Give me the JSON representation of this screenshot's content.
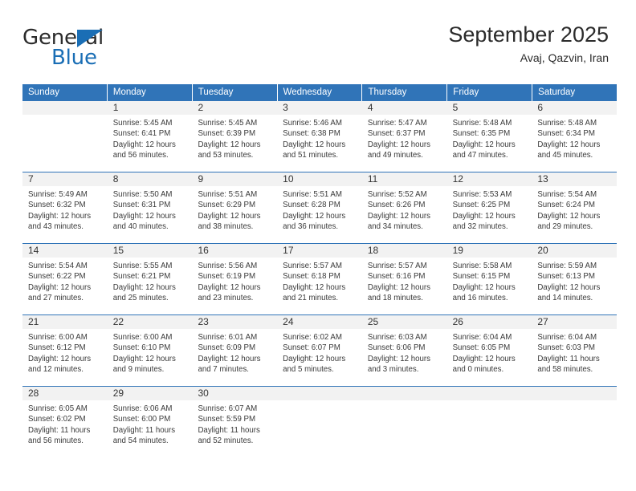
{
  "branding": {
    "logo_text_primary": "General",
    "logo_text_secondary": "Blue",
    "logo_accent_color": "#1a6eb5"
  },
  "header": {
    "title": "September 2025",
    "subtitle": "Avaj, Qazvin, Iran",
    "header_bg_color": "#3074b8",
    "day_band_color": "#f2f2f2"
  },
  "weekdays": [
    "Sunday",
    "Monday",
    "Tuesday",
    "Wednesday",
    "Thursday",
    "Friday",
    "Saturday"
  ],
  "labels": {
    "sunrise_prefix": "Sunrise:",
    "sunset_prefix": "Sunset:",
    "daylight_prefix": "Daylight:"
  },
  "weeks": [
    [
      {
        "day": "",
        "sunrise": "",
        "sunset": "",
        "daylight_line1": "",
        "daylight_line2": ""
      },
      {
        "day": "1",
        "sunrise": "Sunrise: 5:45 AM",
        "sunset": "Sunset: 6:41 PM",
        "daylight_line1": "Daylight: 12 hours",
        "daylight_line2": "and 56 minutes."
      },
      {
        "day": "2",
        "sunrise": "Sunrise: 5:45 AM",
        "sunset": "Sunset: 6:39 PM",
        "daylight_line1": "Daylight: 12 hours",
        "daylight_line2": "and 53 minutes."
      },
      {
        "day": "3",
        "sunrise": "Sunrise: 5:46 AM",
        "sunset": "Sunset: 6:38 PM",
        "daylight_line1": "Daylight: 12 hours",
        "daylight_line2": "and 51 minutes."
      },
      {
        "day": "4",
        "sunrise": "Sunrise: 5:47 AM",
        "sunset": "Sunset: 6:37 PM",
        "daylight_line1": "Daylight: 12 hours",
        "daylight_line2": "and 49 minutes."
      },
      {
        "day": "5",
        "sunrise": "Sunrise: 5:48 AM",
        "sunset": "Sunset: 6:35 PM",
        "daylight_line1": "Daylight: 12 hours",
        "daylight_line2": "and 47 minutes."
      },
      {
        "day": "6",
        "sunrise": "Sunrise: 5:48 AM",
        "sunset": "Sunset: 6:34 PM",
        "daylight_line1": "Daylight: 12 hours",
        "daylight_line2": "and 45 minutes."
      }
    ],
    [
      {
        "day": "7",
        "sunrise": "Sunrise: 5:49 AM",
        "sunset": "Sunset: 6:32 PM",
        "daylight_line1": "Daylight: 12 hours",
        "daylight_line2": "and 43 minutes."
      },
      {
        "day": "8",
        "sunrise": "Sunrise: 5:50 AM",
        "sunset": "Sunset: 6:31 PM",
        "daylight_line1": "Daylight: 12 hours",
        "daylight_line2": "and 40 minutes."
      },
      {
        "day": "9",
        "sunrise": "Sunrise: 5:51 AM",
        "sunset": "Sunset: 6:29 PM",
        "daylight_line1": "Daylight: 12 hours",
        "daylight_line2": "and 38 minutes."
      },
      {
        "day": "10",
        "sunrise": "Sunrise: 5:51 AM",
        "sunset": "Sunset: 6:28 PM",
        "daylight_line1": "Daylight: 12 hours",
        "daylight_line2": "and 36 minutes."
      },
      {
        "day": "11",
        "sunrise": "Sunrise: 5:52 AM",
        "sunset": "Sunset: 6:26 PM",
        "daylight_line1": "Daylight: 12 hours",
        "daylight_line2": "and 34 minutes."
      },
      {
        "day": "12",
        "sunrise": "Sunrise: 5:53 AM",
        "sunset": "Sunset: 6:25 PM",
        "daylight_line1": "Daylight: 12 hours",
        "daylight_line2": "and 32 minutes."
      },
      {
        "day": "13",
        "sunrise": "Sunrise: 5:54 AM",
        "sunset": "Sunset: 6:24 PM",
        "daylight_line1": "Daylight: 12 hours",
        "daylight_line2": "and 29 minutes."
      }
    ],
    [
      {
        "day": "14",
        "sunrise": "Sunrise: 5:54 AM",
        "sunset": "Sunset: 6:22 PM",
        "daylight_line1": "Daylight: 12 hours",
        "daylight_line2": "and 27 minutes."
      },
      {
        "day": "15",
        "sunrise": "Sunrise: 5:55 AM",
        "sunset": "Sunset: 6:21 PM",
        "daylight_line1": "Daylight: 12 hours",
        "daylight_line2": "and 25 minutes."
      },
      {
        "day": "16",
        "sunrise": "Sunrise: 5:56 AM",
        "sunset": "Sunset: 6:19 PM",
        "daylight_line1": "Daylight: 12 hours",
        "daylight_line2": "and 23 minutes."
      },
      {
        "day": "17",
        "sunrise": "Sunrise: 5:57 AM",
        "sunset": "Sunset: 6:18 PM",
        "daylight_line1": "Daylight: 12 hours",
        "daylight_line2": "and 21 minutes."
      },
      {
        "day": "18",
        "sunrise": "Sunrise: 5:57 AM",
        "sunset": "Sunset: 6:16 PM",
        "daylight_line1": "Daylight: 12 hours",
        "daylight_line2": "and 18 minutes."
      },
      {
        "day": "19",
        "sunrise": "Sunrise: 5:58 AM",
        "sunset": "Sunset: 6:15 PM",
        "daylight_line1": "Daylight: 12 hours",
        "daylight_line2": "and 16 minutes."
      },
      {
        "day": "20",
        "sunrise": "Sunrise: 5:59 AM",
        "sunset": "Sunset: 6:13 PM",
        "daylight_line1": "Daylight: 12 hours",
        "daylight_line2": "and 14 minutes."
      }
    ],
    [
      {
        "day": "21",
        "sunrise": "Sunrise: 6:00 AM",
        "sunset": "Sunset: 6:12 PM",
        "daylight_line1": "Daylight: 12 hours",
        "daylight_line2": "and 12 minutes."
      },
      {
        "day": "22",
        "sunrise": "Sunrise: 6:00 AM",
        "sunset": "Sunset: 6:10 PM",
        "daylight_line1": "Daylight: 12 hours",
        "daylight_line2": "and 9 minutes."
      },
      {
        "day": "23",
        "sunrise": "Sunrise: 6:01 AM",
        "sunset": "Sunset: 6:09 PM",
        "daylight_line1": "Daylight: 12 hours",
        "daylight_line2": "and 7 minutes."
      },
      {
        "day": "24",
        "sunrise": "Sunrise: 6:02 AM",
        "sunset": "Sunset: 6:07 PM",
        "daylight_line1": "Daylight: 12 hours",
        "daylight_line2": "and 5 minutes."
      },
      {
        "day": "25",
        "sunrise": "Sunrise: 6:03 AM",
        "sunset": "Sunset: 6:06 PM",
        "daylight_line1": "Daylight: 12 hours",
        "daylight_line2": "and 3 minutes."
      },
      {
        "day": "26",
        "sunrise": "Sunrise: 6:04 AM",
        "sunset": "Sunset: 6:05 PM",
        "daylight_line1": "Daylight: 12 hours",
        "daylight_line2": "and 0 minutes."
      },
      {
        "day": "27",
        "sunrise": "Sunrise: 6:04 AM",
        "sunset": "Sunset: 6:03 PM",
        "daylight_line1": "Daylight: 11 hours",
        "daylight_line2": "and 58 minutes."
      }
    ],
    [
      {
        "day": "28",
        "sunrise": "Sunrise: 6:05 AM",
        "sunset": "Sunset: 6:02 PM",
        "daylight_line1": "Daylight: 11 hours",
        "daylight_line2": "and 56 minutes."
      },
      {
        "day": "29",
        "sunrise": "Sunrise: 6:06 AM",
        "sunset": "Sunset: 6:00 PM",
        "daylight_line1": "Daylight: 11 hours",
        "daylight_line2": "and 54 minutes."
      },
      {
        "day": "30",
        "sunrise": "Sunrise: 6:07 AM",
        "sunset": "Sunset: 5:59 PM",
        "daylight_line1": "Daylight: 11 hours",
        "daylight_line2": "and 52 minutes."
      },
      {
        "day": "",
        "sunrise": "",
        "sunset": "",
        "daylight_line1": "",
        "daylight_line2": ""
      },
      {
        "day": "",
        "sunrise": "",
        "sunset": "",
        "daylight_line1": "",
        "daylight_line2": ""
      },
      {
        "day": "",
        "sunrise": "",
        "sunset": "",
        "daylight_line1": "",
        "daylight_line2": ""
      },
      {
        "day": "",
        "sunrise": "",
        "sunset": "",
        "daylight_line1": "",
        "daylight_line2": ""
      }
    ]
  ]
}
